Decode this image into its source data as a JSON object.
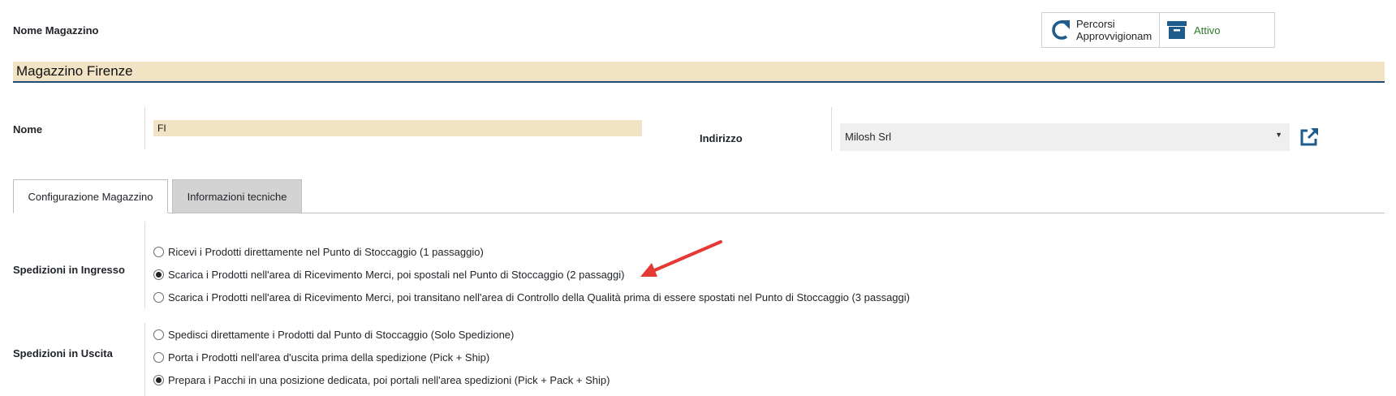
{
  "header": {
    "warehouse_name_label": "Nome Magazzino",
    "warehouse_name_value": "Magazzino Firenze"
  },
  "smart_buttons": {
    "routes_line1": "Percorsi",
    "routes_line2": "Approvvigionam",
    "active_label": "Attivo"
  },
  "fields": {
    "short_name_label": "Nome",
    "short_name_value": "FI",
    "address_label": "Indirizzo",
    "address_value": "Milosh Srl"
  },
  "tabs": [
    {
      "label": "Configurazione Magazzino",
      "active": true
    },
    {
      "label": "Informazioni tecniche",
      "active": false
    }
  ],
  "incoming": {
    "label": "Spedizioni in Ingresso",
    "options": [
      {
        "label": "Ricevi i Prodotti direttamente nel Punto di Stoccaggio (1 passaggio)",
        "checked": false
      },
      {
        "label": "Scarica i Prodotti nell'area di Ricevimento Merci, poi spostali nel Punto di Stoccaggio (2 passaggi)",
        "checked": true
      },
      {
        "label": "Scarica i Prodotti nell'area di Ricevimento Merci, poi transitano nell'area di Controllo della Qualità prima di essere spostati nel Punto di Stoccaggio (3 passaggi)",
        "checked": false
      }
    ]
  },
  "outgoing": {
    "label": "Spedizioni in Uscita",
    "options": [
      {
        "label": "Spedisci direttamente i Prodotti dal Punto di Stoccaggio (Solo Spedizione)",
        "checked": false
      },
      {
        "label": "Porta i Prodotti nell'area d'uscita prima della spedizione (Pick + Ship)",
        "checked": false
      },
      {
        "label": "Prepara i Pacchi in una posizione dedicata, poi portali nell'area spedizioni (Pick + Pack + Ship)",
        "checked": true
      }
    ]
  },
  "colors": {
    "input_bg": "#f2e3c5",
    "accent_blue": "#1f5c8b",
    "active_green": "#2c7a2c",
    "annotation_arrow": "#e53935"
  },
  "icons": {
    "routes": "refresh-icon",
    "active": "archive-icon",
    "external": "external-link-icon",
    "dropdown": "caret-down-icon"
  }
}
